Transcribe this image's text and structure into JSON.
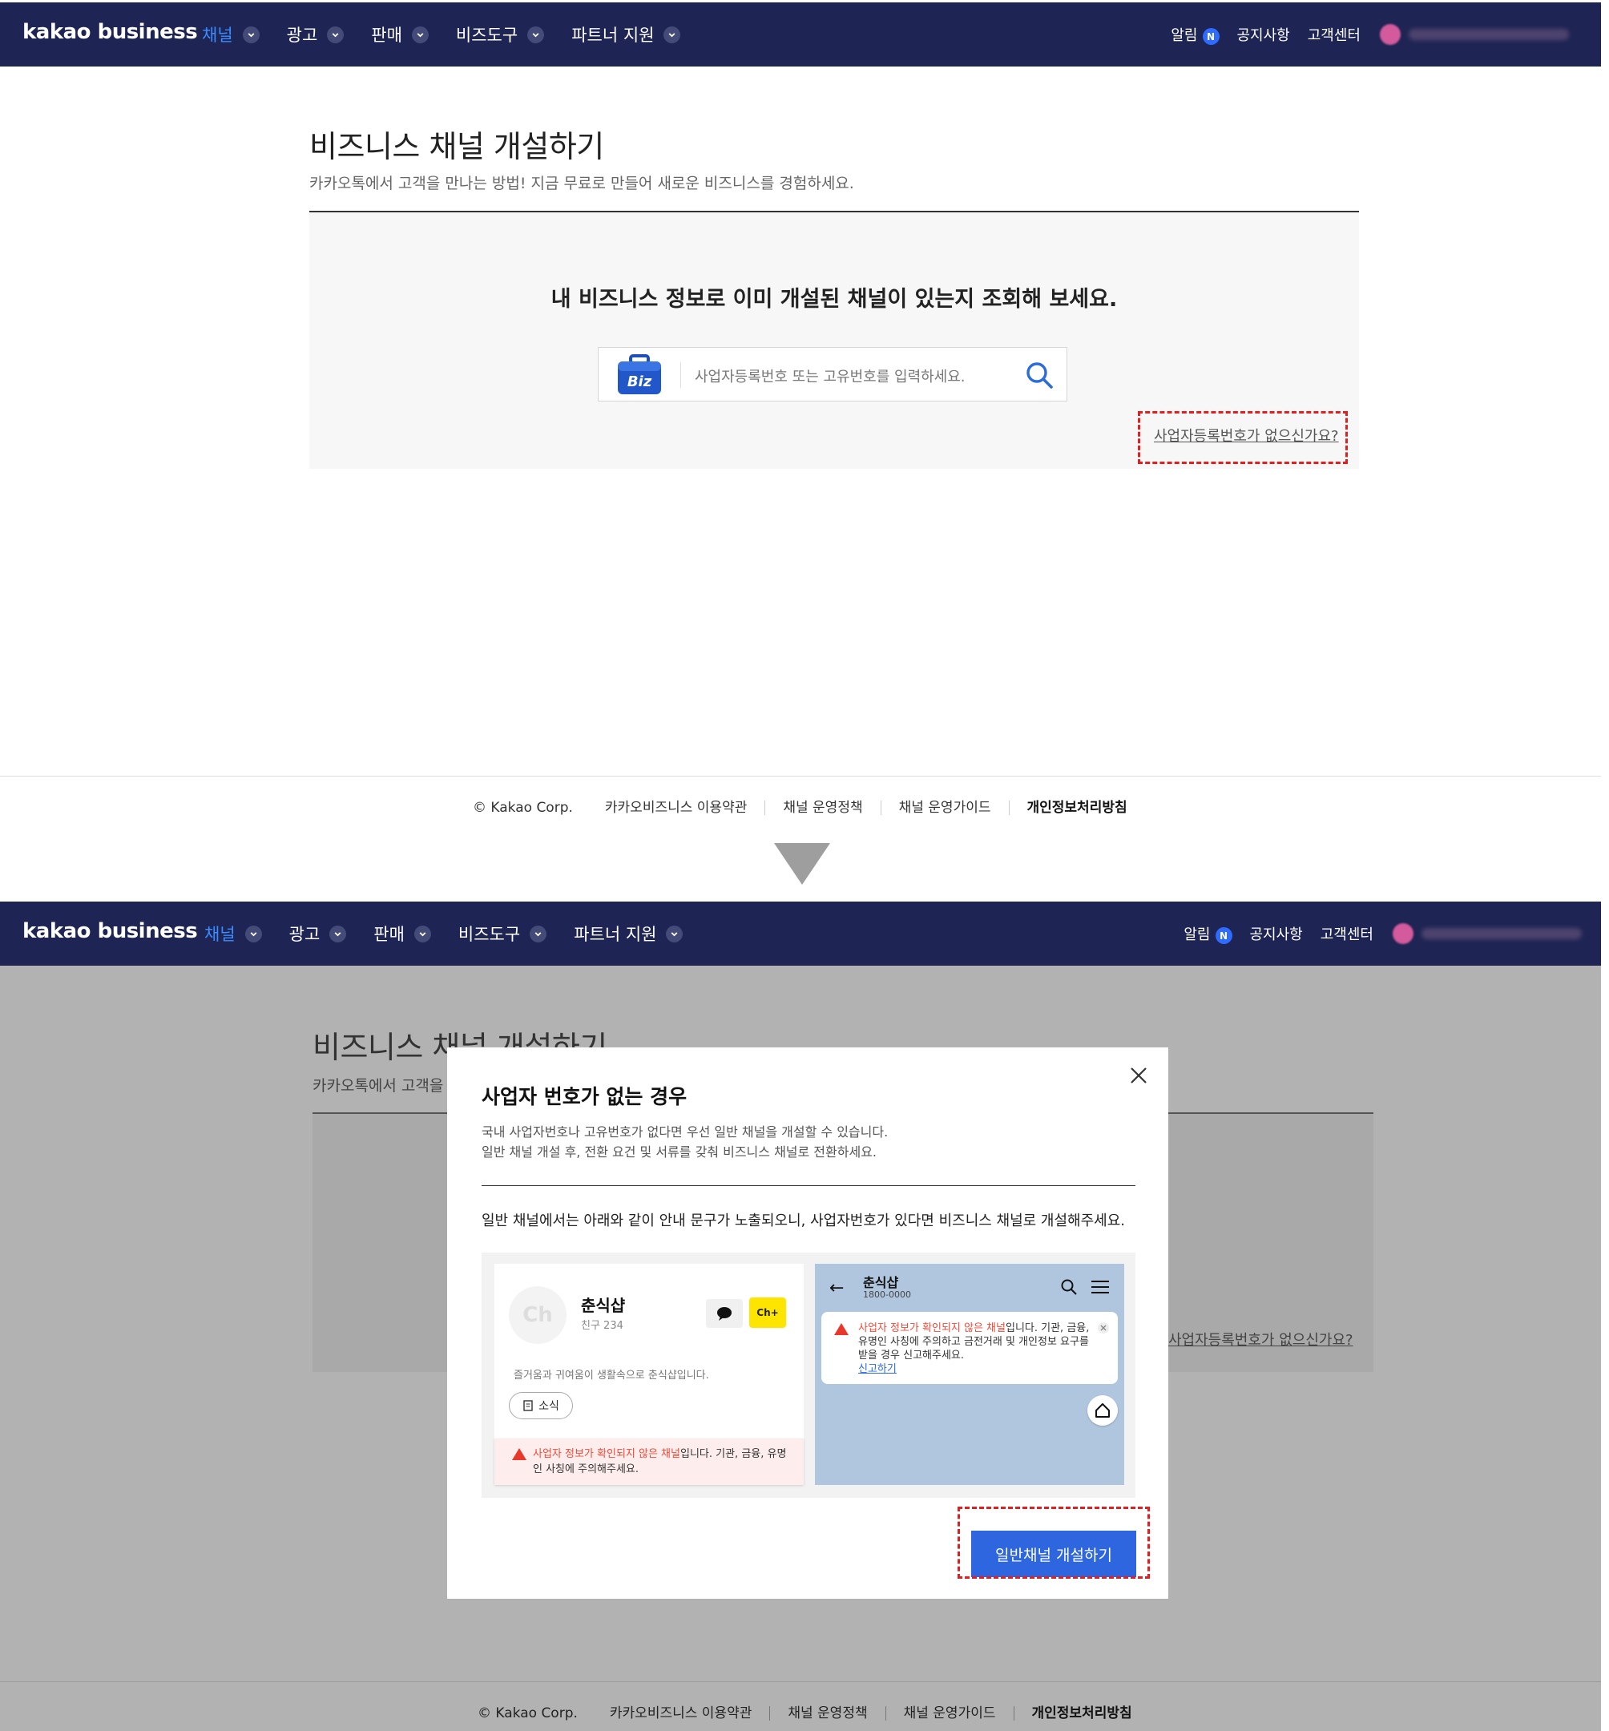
{
  "nav": {
    "logo": "kakao business",
    "menu": [
      "채널",
      "광고",
      "판매",
      "비즈도구",
      "파트너 지원"
    ],
    "notifications": "알림",
    "badge": "N",
    "notice": "공지사항",
    "support": "고객센터"
  },
  "page": {
    "title": "비즈니스 채널 개설하기",
    "subtitle": "카카오톡에서 고객을 만나는 방법! 지금 무료로 만들어 새로운 비즈니스를 경험하세요.",
    "question": "내 비즈니스 정보로 이미 개설된 채널이 있는지 조회해 보세요.",
    "search_placeholder": "사업자등록번호 또는 고유번호를 입력하세요.",
    "biz_badge": "Biz",
    "no_biz_link": "사업자등록번호가 없으신가요?",
    "dim_subtitle": "카카오톡에서 고객을"
  },
  "footer": {
    "copyright": "© Kakao Corp.",
    "links": [
      "카카오비즈니스 이용약관",
      "채널 운영정책",
      "채널 운영가이드",
      "개인정보처리방침"
    ]
  },
  "modal": {
    "title": "사업자 번호가 없는 경우",
    "desc1": "국내 사업자번호나 고유번호가 없다면 우선 일반 채널을 개설할 수 있습니다.",
    "desc2": "일반 채널 개설 후, 전환 요건 및 서류를 갖춰 비즈니스 채널로 전환하세요.",
    "note": "일반 채널에서는 아래와 같이 안내 문구가 노출되오니, 사업자번호가 있다면 비즈니스 채널로 개설해주세요.",
    "button": "일반채널 개설하기",
    "preview": {
      "ch_logo": "Ch",
      "name": "춘식샵",
      "friends": "친구 234",
      "add_label": "Ch+",
      "desc": "즐거움과 귀여움이 생활속으로 춘식샵입니다.",
      "news": "소식",
      "warn_red": "사업자 정보가 확인되지 않은 채널",
      "warn_rest": "입니다. 기관, 금융, 유명인 사칭에 주의해주세요.",
      "chat_name": "춘식샵",
      "chat_number": "1800-0000",
      "chat_warn_red": "사업자 정보가 확인되지 않은 채널",
      "chat_warn_rest": "입니다. 기관, 금융, 유명인 사칭에 주의하고 금전거래 및 개인정보 요구를 받을 경우 신고해주세요.",
      "report": "신고하기"
    }
  },
  "colors": {
    "nav_bg": "#1e2453",
    "active_menu": "#3b8cff",
    "primary_button": "#2d66df",
    "highlight_dash": "#e02020",
    "warn_red": "#ef4b3a",
    "kakao_yellow": "#fee500"
  }
}
